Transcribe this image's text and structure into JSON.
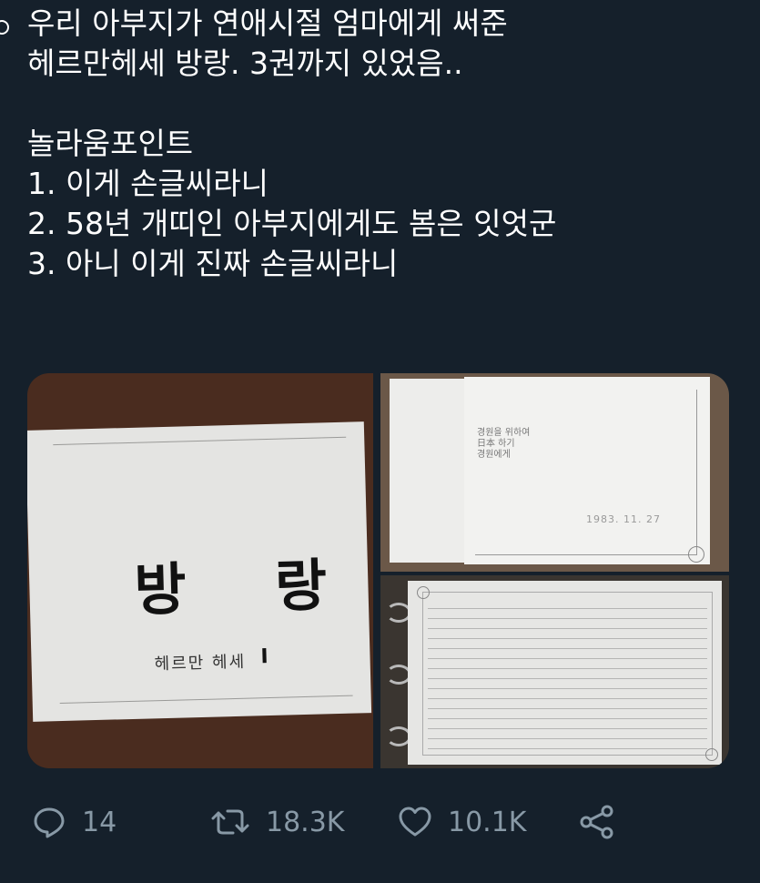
{
  "tweet": {
    "lines": [
      "우리 아부지가 연애시절 엄마에게 써준",
      "헤르만헤세 방랑. 3권까지 있었음..",
      "",
      "놀라움포인트",
      "1. 이게 손글씨라니",
      "2. 58년 개띠인 아부지에게도 봄은 잇엇군",
      "3. 아니 이게 진짜 손글씨라니"
    ]
  },
  "media": {
    "photo1": {
      "title": "방 랑",
      "subtitle": "헤르만 헤세",
      "volume": "I"
    },
    "photo2": {
      "dedication": [
        "경원을 위하여",
        "日本 하기",
        "경원에게"
      ],
      "date": "1983. 11. 27"
    }
  },
  "actions": {
    "reply": {
      "icon": "reply-icon",
      "count": "14"
    },
    "retweet": {
      "icon": "retweet-icon",
      "count": "18.3K"
    },
    "like": {
      "icon": "heart-icon",
      "count": "10.1K"
    },
    "share": {
      "icon": "share-icon"
    }
  },
  "colors": {
    "background": "#15202b",
    "text": "#ffffff",
    "muted": "#8899a6"
  }
}
